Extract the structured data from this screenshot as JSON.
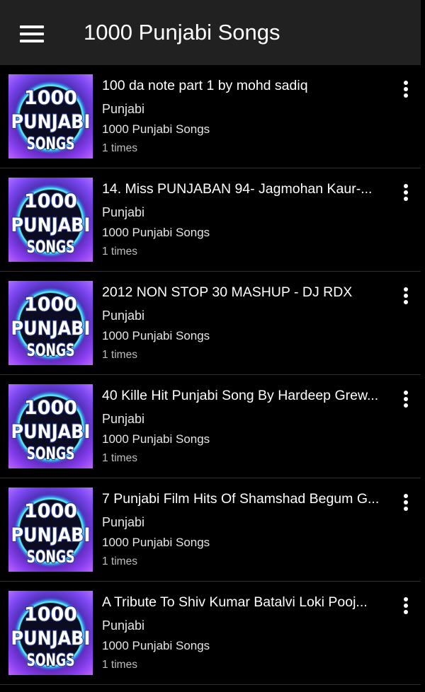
{
  "header": {
    "menu_icon": "hamburger-menu-icon",
    "title": "1000 Punjabi Songs"
  },
  "logo": {
    "lines": [
      "1000",
      "PUNJABI",
      "SONGS"
    ]
  },
  "songs": [
    {
      "title": "100 da note part 1 by mohd sadiq",
      "genre": "Punjabi",
      "album": "1000 Punjabi Songs",
      "plays": "1 times"
    },
    {
      "title": "14. Miss PUNJABAN 94- Jagmohan Kaur-...",
      "genre": "Punjabi",
      "album": "1000 Punjabi Songs",
      "plays": "1 times"
    },
    {
      "title": "2012 NON STOP 30 MASHUP - DJ RDX",
      "genre": "Punjabi",
      "album": "1000 Punjabi Songs",
      "plays": "1 times"
    },
    {
      "title": "40 Kille Hit Punjabi Song By Hardeep Grew...",
      "genre": "Punjabi",
      "album": "1000 Punjabi Songs",
      "plays": "1 times"
    },
    {
      "title": "7 Punjabi Film Hits Of Shamshad Begum G...",
      "genre": "Punjabi",
      "album": "1000 Punjabi Songs",
      "plays": "1 times"
    },
    {
      "title": "A Tribute To Shiv Kumar Batalvi   Loki Pooj...",
      "genre": "Punjabi",
      "album": "1000 Punjabi Songs",
      "plays": "1 times"
    }
  ],
  "colors": {
    "appbar": "#212121",
    "background": "#000000",
    "logo_text": "#ffffff",
    "logo_outline": "#2a3a8a",
    "logo_bg_outer": "#7b2fd6",
    "logo_bg_inner": "#0c0c24"
  }
}
